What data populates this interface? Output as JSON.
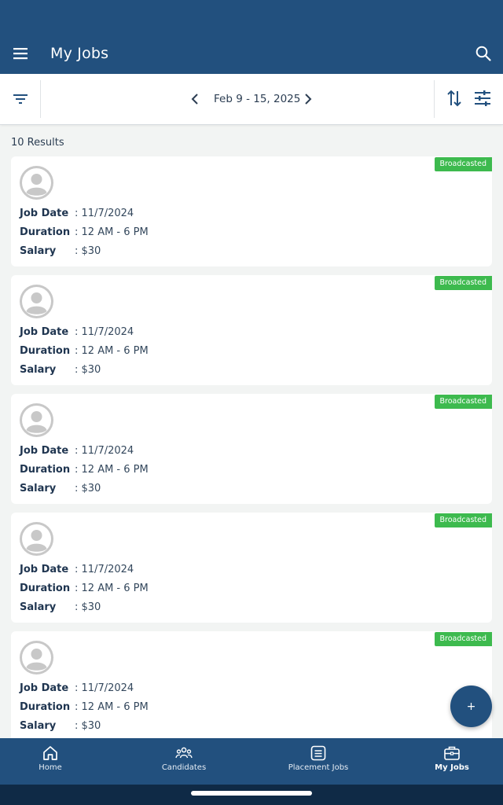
{
  "app_bar": {
    "title": "My Jobs"
  },
  "toolbar": {
    "date_range": "Feb 9 - 15, 2025"
  },
  "results_label": "10 Results",
  "jobs": [
    {
      "status": "Broadcasted",
      "job_date_label": "Job Date",
      "job_date": "11/7/2024",
      "duration_label": "Duration",
      "duration": "12 AM - 6 PM",
      "salary_label": "Salary",
      "salary": "$30"
    },
    {
      "status": "Broadcasted",
      "job_date_label": "Job Date",
      "job_date": "11/7/2024",
      "duration_label": "Duration",
      "duration": "12 AM - 6 PM",
      "salary_label": "Salary",
      "salary": "$30"
    },
    {
      "status": "Broadcasted",
      "job_date_label": "Job Date",
      "job_date": "11/7/2024",
      "duration_label": "Duration",
      "duration": "12 AM - 6 PM",
      "salary_label": "Salary",
      "salary": "$30"
    },
    {
      "status": "Broadcasted",
      "job_date_label": "Job Date",
      "job_date": "11/7/2024",
      "duration_label": "Duration",
      "duration": "12 AM - 6 PM",
      "salary_label": "Salary",
      "salary": "$30"
    },
    {
      "status": "Broadcasted",
      "job_date_label": "Job Date",
      "job_date": "11/7/2024",
      "duration_label": "Duration",
      "duration": "12 AM - 6 PM",
      "salary_label": "Salary",
      "salary": "$30"
    }
  ],
  "fab": {
    "label": "+"
  },
  "bottom_nav": [
    {
      "label": "Home",
      "icon": "home-icon"
    },
    {
      "label": "Candidates",
      "icon": "people-icon"
    },
    {
      "label": "Placement Jobs",
      "icon": "list-icon"
    },
    {
      "label": "My Jobs",
      "icon": "briefcase-icon",
      "active": true
    }
  ],
  "colors": {
    "primary": "#22507e",
    "badge": "#3dba4e",
    "background": "#f2f4f3"
  }
}
